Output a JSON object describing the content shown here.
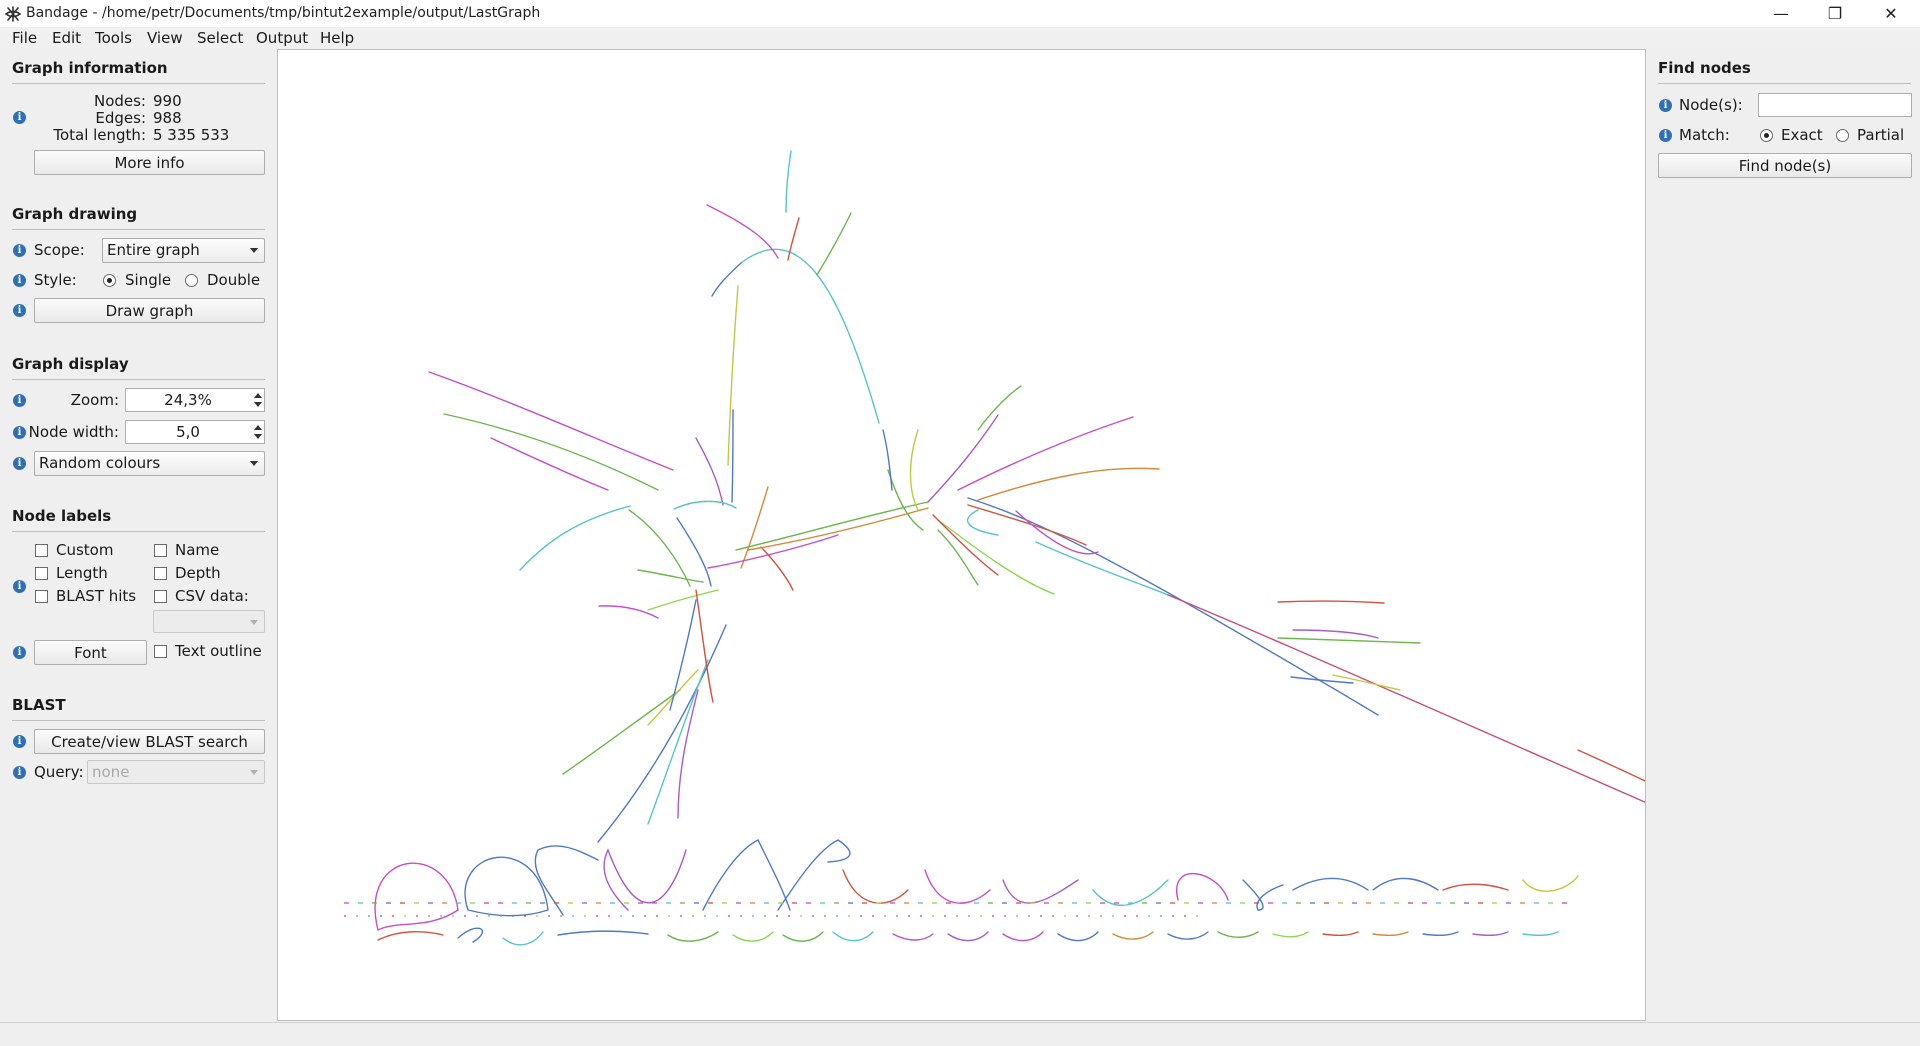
{
  "window": {
    "title": "Bandage - /home/petr/Documents/tmp/bintut2example/output/LastGraph",
    "controls": {
      "minimize": "—",
      "maximize": "❐",
      "close": "✕"
    }
  },
  "menu": [
    "File",
    "Edit",
    "Tools",
    "View",
    "Select",
    "Output",
    "Help"
  ],
  "graph_info": {
    "title": "Graph information",
    "nodes_label": "Nodes:",
    "nodes_value": "990",
    "edges_label": "Edges:",
    "edges_value": "988",
    "length_label": "Total length:",
    "length_value": "5 335 533",
    "more_info_button": "More info"
  },
  "graph_drawing": {
    "title": "Graph drawing",
    "scope_label": "Scope:",
    "scope_value": "Entire graph",
    "style_label": "Style:",
    "style_single": "Single",
    "style_double": "Double",
    "style_selected": "Single",
    "draw_button": "Draw graph"
  },
  "graph_display": {
    "title": "Graph display",
    "zoom_label": "Zoom:",
    "zoom_value": "24,3%",
    "node_width_label": "Node width:",
    "node_width_value": "5,0",
    "colour_scheme": "Random colours"
  },
  "node_labels": {
    "title": "Node labels",
    "custom": "Custom",
    "name": "Name",
    "length": "Length",
    "depth": "Depth",
    "blast_hits": "BLAST hits",
    "csv_data": "CSV data:",
    "font_button": "Font",
    "text_outline": "Text outline"
  },
  "blast": {
    "title": "BLAST",
    "search_button": "Create/view BLAST search",
    "query_label": "Query:",
    "query_value": "none"
  },
  "find_nodes": {
    "title": "Find nodes",
    "nodes_label": "Node(s):",
    "nodes_value": "",
    "match_label": "Match:",
    "match_exact": "Exact",
    "match_partial": "Partial",
    "match_selected": "Exact",
    "find_button": "Find node(s)"
  },
  "colors": {
    "accent_info": "#2f6fb5",
    "graph_palette": [
      "#c64fc4",
      "#55c4c9",
      "#6db54d",
      "#4f79c7",
      "#d2533f",
      "#c2c73c",
      "#a65cc9",
      "#d08a3a",
      "#58b6e0",
      "#8fd64f",
      "#c74e7a"
    ]
  }
}
